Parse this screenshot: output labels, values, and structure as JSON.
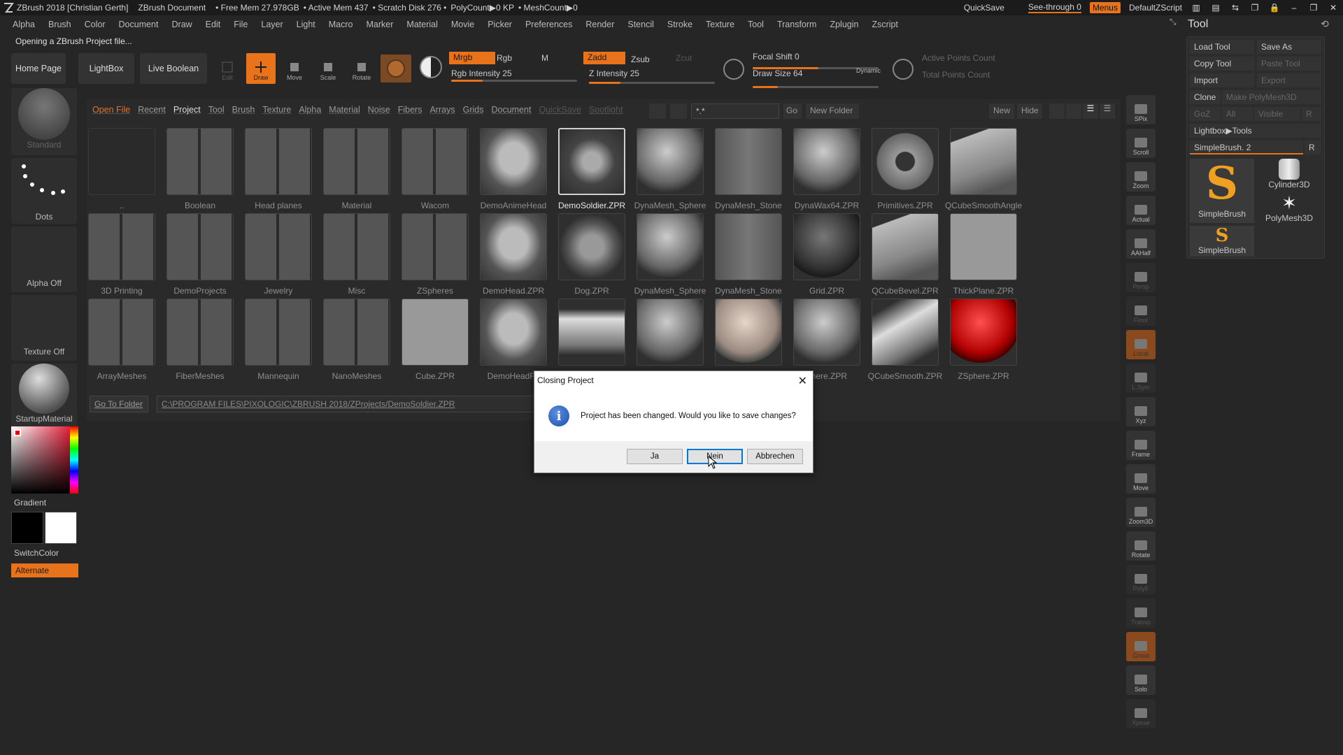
{
  "titlebar": {
    "app_title": "ZBrush 2018 [Christian Gerth]",
    "document": "ZBrush Document",
    "free_mem": "• Free Mem 27.978GB",
    "active_mem": "• Active Mem 437",
    "scratch": "• Scratch Disk 276 •",
    "polycount": "PolyCount▶0 KP",
    "meshcount": "• MeshCount▶0",
    "quicksave": "QuickSave",
    "see_through": "See-through  0",
    "menus": "Menus",
    "default_zscript": "DefaultZScript"
  },
  "menubar": [
    "Alpha",
    "Brush",
    "Color",
    "Document",
    "Draw",
    "Edit",
    "File",
    "Layer",
    "Light",
    "Macro",
    "Marker",
    "Material",
    "Movie",
    "Picker",
    "Preferences",
    "Render",
    "Stencil",
    "Stroke",
    "Texture",
    "Tool",
    "Transform",
    "Zplugin",
    "Zscript"
  ],
  "notice": "Opening a ZBrush Project file...",
  "topshelf": {
    "home": "Home Page",
    "lightbox": "LightBox",
    "live_boolean": "Live Boolean",
    "edit": "Edit",
    "draw": "Draw",
    "move": "Move",
    "scale": "Scale",
    "rotate": "Rotate",
    "mrgb": "Mrgb",
    "rgb": "Rgb",
    "m": "M",
    "zadd": "Zadd",
    "zsub": "Zsub",
    "zcut": "Zcut",
    "rgb_intensity": "Rgb Intensity 25",
    "z_intensity": "Z Intensity 25",
    "focal_shift": "Focal Shift 0",
    "draw_size": "Draw Size 64",
    "dynamic": "Dynamic",
    "active_points": "Active Points Count",
    "total_points": "Total Points Count",
    "rgb_intensity_value": 25,
    "z_intensity_value": 25
  },
  "leftcol": {
    "standard": "Standard",
    "dots": "Dots",
    "alpha_off": "Alpha Off",
    "texture_off": "Texture Off",
    "startup_material": "StartupMaterial",
    "gradient": "Gradient",
    "switchcolor": "SwitchColor",
    "alternate": "Alternate"
  },
  "browser": {
    "tabs": [
      "Open File",
      "Recent",
      "Project",
      "Tool",
      "Brush",
      "Texture",
      "Alpha",
      "Material",
      "Noise",
      "Fibers",
      "Arrays",
      "Grids",
      "Document",
      "QuickSave",
      "Spotlight"
    ],
    "search_value": "*.*",
    "go": "Go",
    "new_folder": "New Folder",
    "new": "New",
    "hide": "Hide",
    "go_to_folder": "Go To Folder",
    "path": "C:\\PROGRAM FILES\\PIXOLOGIC\\ZBRUSH 2018/ZProjects/DemoSoldier.ZPR",
    "items": [
      {
        "label": "..",
        "kind": "empty"
      },
      {
        "label": "Boolean",
        "kind": "folder"
      },
      {
        "label": "Head planes",
        "kind": "folder"
      },
      {
        "label": "Material",
        "kind": "folder"
      },
      {
        "label": "Wacom",
        "kind": "folder"
      },
      {
        "label": "DemoAnimeHead",
        "kind": "head"
      },
      {
        "label": "DemoSoldier.ZPR",
        "kind": "figure"
      },
      {
        "label": "DynaMesh_Sphere",
        "kind": "sphere"
      },
      {
        "label": "DynaMesh_Stone",
        "kind": "plane"
      },
      {
        "label": "DynaWax64.ZPR",
        "kind": "sphere"
      },
      {
        "label": "Primitives.ZPR",
        "kind": "tube"
      },
      {
        "label": "QCubeSmoothAngle",
        "kind": "cube"
      },
      {
        "label": "3D Printing",
        "kind": "folder"
      },
      {
        "label": "DemoProjects",
        "kind": "folder"
      },
      {
        "label": "Jewelry",
        "kind": "folder"
      },
      {
        "label": "Misc",
        "kind": "folder"
      },
      {
        "label": "ZSpheres",
        "kind": "folder"
      },
      {
        "label": "DemoHead.ZPR",
        "kind": "head"
      },
      {
        "label": "Dog.ZPR",
        "kind": "dog"
      },
      {
        "label": "DynaMesh_Sphere",
        "kind": "sphere"
      },
      {
        "label": "DynaMesh_Stone",
        "kind": "plane"
      },
      {
        "label": "Grid.ZPR",
        "kind": "darksphere"
      },
      {
        "label": "QCubeBevel.ZPR",
        "kind": "cube"
      },
      {
        "label": "ThickPlane.ZPR",
        "kind": "flat"
      },
      {
        "label": "ArrayMeshes",
        "kind": "folder"
      },
      {
        "label": "FiberMeshes",
        "kind": "folder"
      },
      {
        "label": "Mannequin",
        "kind": "folder"
      },
      {
        "label": "NanoMeshes",
        "kind": "folder"
      },
      {
        "label": "Cube.ZPR",
        "kind": "flat"
      },
      {
        "label": "DemoHeadFe",
        "kind": "head"
      },
      {
        "label": "",
        "kind": "cylinder"
      },
      {
        "label": "",
        "kind": "sphere"
      },
      {
        "label": "",
        "kind": "skinsphere"
      },
      {
        "label": "phere.ZPR",
        "kind": "sphere"
      },
      {
        "label": "QCubeSmooth.ZPR",
        "kind": "capsule"
      },
      {
        "label": "ZSphere.ZPR",
        "kind": "redsphere"
      }
    ]
  },
  "rightdock": [
    "SPix",
    "Scroll",
    "Zoom",
    "Actual",
    "AAHalf",
    "Persp",
    "Floor",
    "Local",
    "L.Sym",
    "Xyz",
    "Frame",
    "Move",
    "Zoom3D",
    "Rotate",
    "PolyF",
    "Transp",
    "Ghost",
    "Solo",
    "Xpose"
  ],
  "toolpanel": {
    "title": "Tool",
    "load_tool": "Load Tool",
    "save_as": "Save As",
    "copy_tool": "Copy Tool",
    "paste_tool": "Paste Tool",
    "import": "Import",
    "export": "Export",
    "clone": "Clone",
    "make_polymesh": "Make PolyMesh3D",
    "goz": "GoZ",
    "all": "All",
    "visible": "Visible",
    "r": "R",
    "lightbox_tools": "Lightbox▶Tools",
    "simplebrush_slider": "SimpleBrush. 2",
    "tools": [
      "SimpleBrush",
      "Cylinder3D",
      "PolyMesh3D",
      "SimpleBrush"
    ]
  },
  "dialog": {
    "title": "Closing Project",
    "message": "Project has been changed. Would you like to save changes?",
    "yes": "Ja",
    "no": "Nein",
    "cancel": "Abbrechen"
  },
  "colors": {
    "accent": "#e8731a",
    "background": "#262626"
  }
}
